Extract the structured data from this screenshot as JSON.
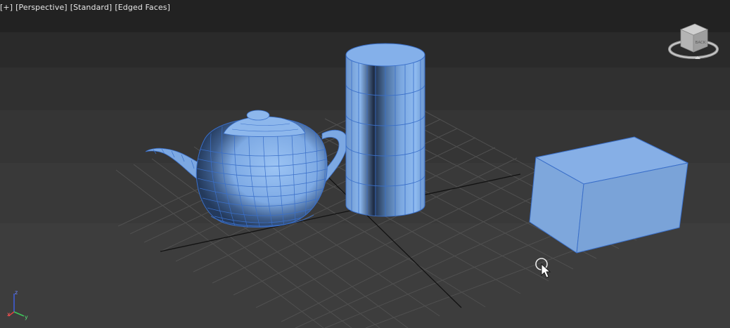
{
  "viewport": {
    "label_parts": [
      "[+]",
      "[Perspective]",
      "[Standard]",
      "[Edged Faces]"
    ]
  },
  "viewcube": {
    "face_label": "BACK"
  },
  "axis_tripod": {
    "x_label": "x",
    "y_label": "y",
    "z_label": "z"
  },
  "colors": {
    "object_blue": "#7faee8",
    "edge_blue": "#3a6fc9",
    "grid": "#4f4f4f",
    "grid_axis": "#141414"
  }
}
